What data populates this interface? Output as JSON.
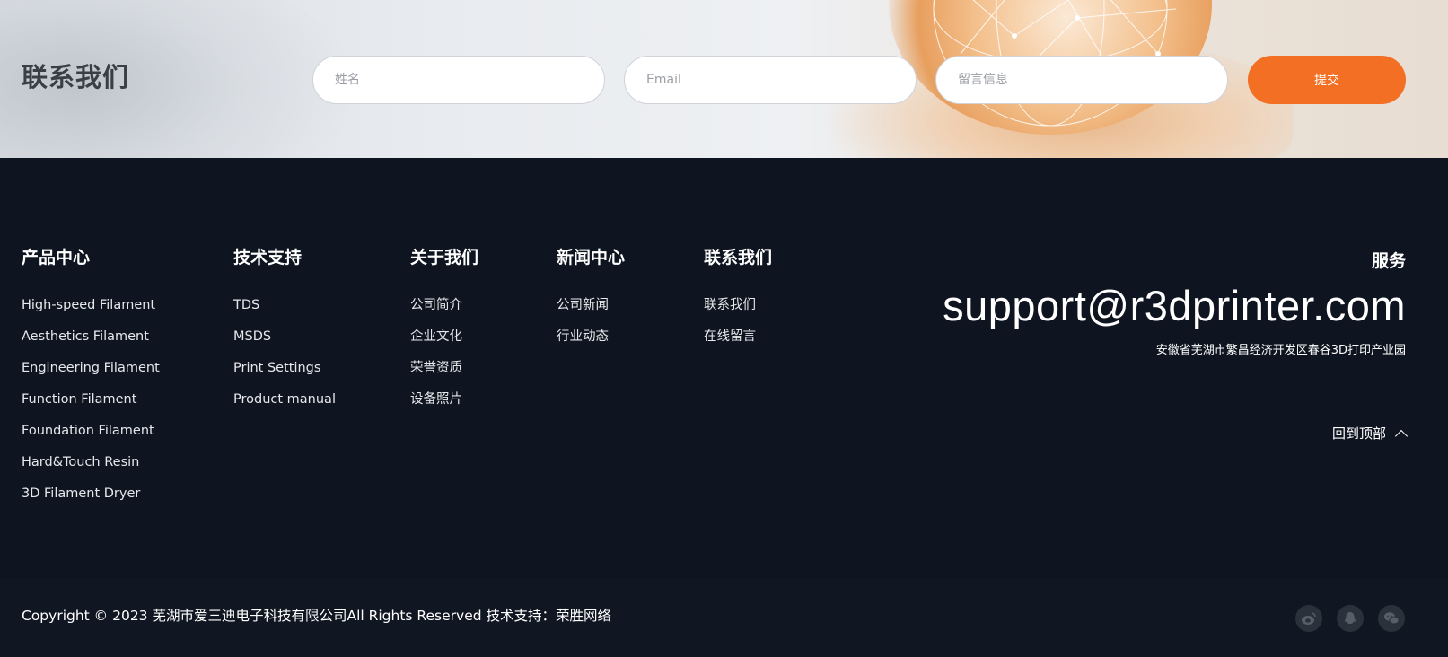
{
  "contact": {
    "title": "联系我们",
    "name_placeholder": "姓名",
    "email_placeholder": "Email",
    "message_placeholder": "留言信息",
    "submit_label": "提交"
  },
  "footer": {
    "columns": [
      {
        "title": "产品中心",
        "links": [
          "High-speed Filament",
          "Aesthetics Filament",
          "Engineering Filament",
          "Function Filament",
          "Foundation Filament",
          "Hard&Touch Resin",
          "3D Filament Dryer"
        ]
      },
      {
        "title": "技术支持",
        "links": [
          "TDS",
          "MSDS",
          "Print Settings",
          "Product manual"
        ]
      },
      {
        "title": "关于我们",
        "links": [
          "公司简介",
          "企业文化",
          "荣誉资质",
          "设备照片"
        ]
      },
      {
        "title": "新闻中心",
        "links": [
          "公司新闻",
          "行业动态"
        ]
      },
      {
        "title": "联系我们",
        "links": [
          "联系我们",
          "在线留言"
        ]
      }
    ],
    "service": {
      "title": "服务",
      "email": "support@r3dprinter.com",
      "address": "安徽省芜湖市繁昌经济开发区春谷3D打印产业园"
    },
    "back_to_top": "回到顶部"
  },
  "bottom": {
    "copyright": "Copyright © 2023 芜湖市爱三迪电子科技有限公司All Rights Reserved 技术支持：荣胜网络",
    "social_icons": [
      "weibo-icon",
      "qq-icon",
      "wechat-icon"
    ]
  },
  "colors": {
    "accent": "#f36f24",
    "footer_bg": "#0f1520",
    "bottom_bg": "#111722"
  }
}
